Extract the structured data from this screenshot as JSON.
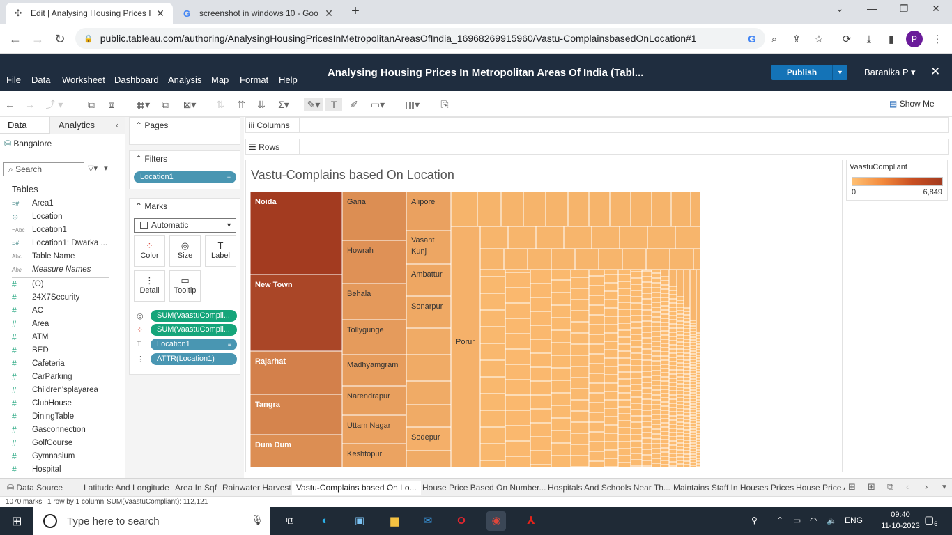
{
  "browser": {
    "tabs": [
      {
        "title": "Edit | Analysing Housing Prices I",
        "icon": "tableau-icon",
        "active": true
      },
      {
        "title": "screenshot in windows 10 - Goo",
        "icon": "google-icon",
        "active": false
      }
    ],
    "url": "public.tableau.com/authoring/AnalysingHousingPricesInMetropolitanAreasOfIndia_16968269915960/Vastu-ComplainsbasedOnLocation#1",
    "profile_initial": "P"
  },
  "tableau": {
    "menu": [
      "File",
      "Data",
      "Worksheet",
      "Dashboard",
      "Analysis",
      "Map",
      "Format",
      "Help"
    ],
    "workbook_title": "Analysing Housing Prices In Metropolitan Areas Of India (Tabl...",
    "publish_label": "Publish",
    "user": "Baranika P",
    "show_me": "Show Me"
  },
  "data_pane": {
    "tabs": [
      "Data",
      "Analytics"
    ],
    "source": "Bangalore",
    "search_placeholder": "Search",
    "tables_header": "Tables",
    "dims": [
      {
        "name": "Area1",
        "icon": "=#"
      },
      {
        "name": "Location",
        "icon": "globe"
      },
      {
        "name": "Location1",
        "icon": "=Abc"
      },
      {
        "name": "Location1: Dwarka ...",
        "icon": "=#"
      },
      {
        "name": "Table Name",
        "icon": "Abc"
      },
      {
        "name": "Measure Names",
        "icon": "Abc"
      }
    ],
    "measures": [
      "(O)",
      "24X7Security",
      "AC",
      "Area",
      "ATM",
      "BED",
      "Cafeteria",
      "CarParking",
      "Children'splayarea",
      "ClubHouse",
      "DiningTable",
      "Gasconnection",
      "GolfCourse",
      "Gymnasium",
      "Hospital"
    ]
  },
  "cards": {
    "pages_title": "Pages",
    "filters_title": "Filters",
    "filter_pill": "Location1",
    "marks_title": "Marks",
    "mark_type": "Automatic",
    "mark_buttons": [
      "Color",
      "Size",
      "Label",
      "Detail",
      "Tooltip"
    ],
    "mark_rows": [
      {
        "label": "SUM(VaastuCompli...",
        "color": "green",
        "icon": "size-icon"
      },
      {
        "label": "SUM(VaastuCompli...",
        "color": "green",
        "icon": "color-icon"
      },
      {
        "label": "Location1",
        "color": "blue",
        "icon": "label-icon"
      },
      {
        "label": "ATTR(Location1)",
        "color": "blue",
        "icon": "detail-icon"
      }
    ]
  },
  "shelves": {
    "columns": "Columns",
    "rows": "Rows"
  },
  "viz": {
    "title": "Vastu-Complains based On Location",
    "labels": [
      "Noida",
      "New Town",
      "Rajarhat",
      "Tangra",
      "Dum Dum",
      "Garia",
      "Howrah",
      "Behala",
      "Tollygunge",
      "Madhyamgram",
      "Narendrapur",
      "Uttam Nagar",
      "Keshtopur",
      "Alipore",
      "Vasant Kunj",
      "Ambattur",
      "Sonarpur",
      "Sodepur",
      "Porur"
    ]
  },
  "chart_data": {
    "type": "treemap",
    "title": "Vastu-Complains based On Location",
    "measure": "SUM(VaastuCompliant)",
    "color_scale": {
      "field": "VaastuCompliant",
      "min": 0,
      "max": 6849,
      "from": "#ffc073",
      "to": "#a33b20"
    },
    "labeled_nodes": [
      {
        "label": "Noida",
        "value": 6849
      },
      {
        "label": "New Town",
        "value": 6300
      },
      {
        "label": "Rajarhat",
        "value": 3300
      },
      {
        "label": "Tangra",
        "value": 3100
      },
      {
        "label": "Dum Dum",
        "value": 2600
      },
      {
        "label": "Garia",
        "value": 2600
      },
      {
        "label": "Howrah",
        "value": 2400
      },
      {
        "label": "Behala",
        "value": 2000
      },
      {
        "label": "Tollygunge",
        "value": 1900
      },
      {
        "label": "Madhyamgram",
        "value": 1800
      },
      {
        "label": "Narendrapur",
        "value": 1700
      },
      {
        "label": "Uttam Nagar",
        "value": 1600
      },
      {
        "label": "Keshtopur",
        "value": 1500
      },
      {
        "label": "Alipore",
        "value": 1600
      },
      {
        "label": "Vasant Kunj",
        "value": 1350
      },
      {
        "label": "Ambattur",
        "value": 1300
      },
      {
        "label": "Sonarpur",
        "value": 1200
      },
      {
        "label": "Sodepur",
        "value": 850
      },
      {
        "label": "Porur",
        "value": 760
      }
    ],
    "legend": {
      "title": "VaastuCompliant",
      "min_label": "0",
      "max_label": "6,849"
    }
  },
  "legend": {
    "title": "VaastuCompliant",
    "min": "0",
    "max": "6,849"
  },
  "sheet_tabs": {
    "data_source": "Data Source",
    "sheets": [
      "Latitude And Longitude",
      "Area In Sqf",
      "Rainwater Harvest",
      "Vastu-Complains based On Lo...",
      "House Price Based On Number...",
      "Hospitals And Schools Near Th...",
      "Maintains Staff In Houses Prices",
      "House Price A"
    ],
    "active_index": 3
  },
  "status": {
    "marks": "1070 marks",
    "grid": "1 row by 1 column",
    "sum": "SUM(VaastuCompliant): 112,121"
  },
  "taskbar": {
    "search_placeholder": "Type here to search",
    "lang": "ENG",
    "time": "09:40",
    "date": "11-10-2023",
    "notif_count": "6"
  }
}
